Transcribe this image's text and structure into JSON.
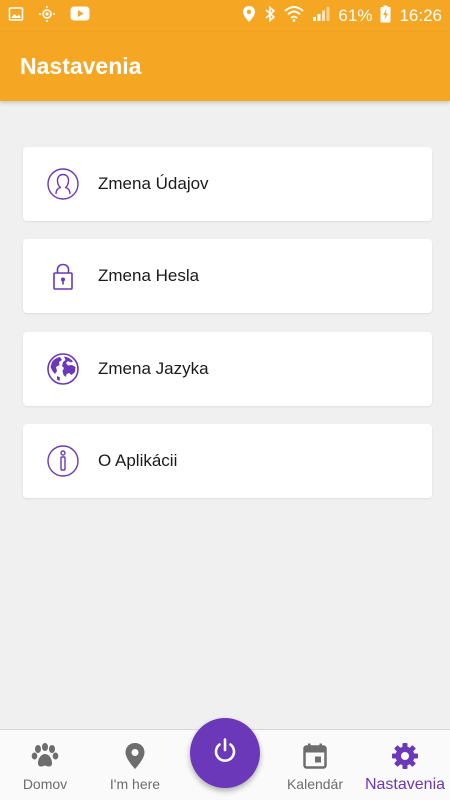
{
  "status_bar": {
    "battery": "61%",
    "time": "16:26",
    "icons": [
      "image-icon",
      "brightness-icon",
      "youtube-icon",
      "location-icon",
      "bluetooth-icon",
      "wifi-icon",
      "signal-icon",
      "battery-charging-icon"
    ]
  },
  "app_bar": {
    "title": "Nastavenia"
  },
  "settings": {
    "items": [
      {
        "label": "Zmena Údajov",
        "icon": "user-icon"
      },
      {
        "label": "Zmena Hesla",
        "icon": "lock-icon"
      },
      {
        "label": "Zmena Jazyka",
        "icon": "globe-icon"
      },
      {
        "label": "O Aplikácii",
        "icon": "info-icon"
      }
    ]
  },
  "bottom_nav": {
    "items": [
      {
        "label": "Domov",
        "icon": "paw-icon"
      },
      {
        "label": "I'm here",
        "icon": "location-pin-icon"
      },
      {
        "label": "Kalendár",
        "icon": "calendar-icon"
      },
      {
        "label": "Nastavenia",
        "icon": "gear-icon",
        "active": true
      }
    ],
    "fab_icon": "power-icon"
  },
  "colors": {
    "accent": "#f5a623",
    "primary": "#6a38b8",
    "background": "#f0f0f0",
    "inactive_nav": "#6d6d6d"
  }
}
